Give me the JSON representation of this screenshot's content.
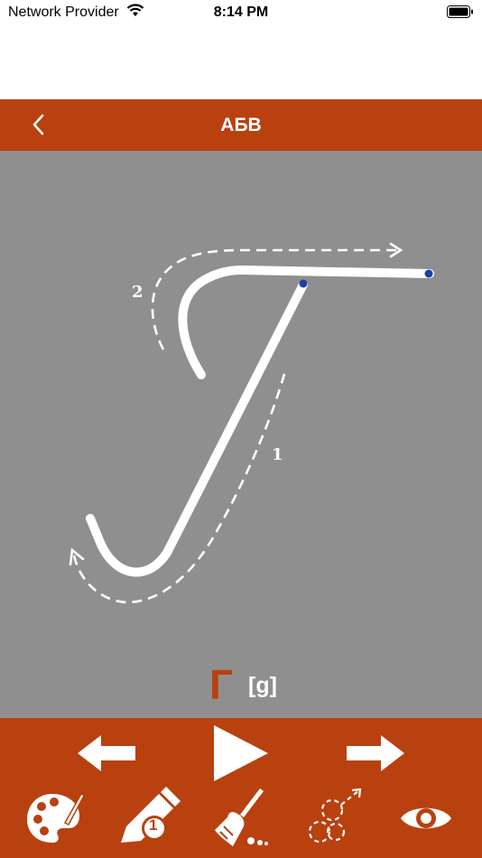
{
  "status_bar": {
    "carrier": "Network Provider",
    "time": "8:14 PM"
  },
  "nav": {
    "title": "АБВ",
    "back_icon": "chevron-left-icon"
  },
  "lesson": {
    "letter": "Г",
    "sound": "[g]",
    "stroke_labels": [
      "1",
      "2"
    ]
  },
  "toolbar": {
    "previous_icon": "arrow-left-icon",
    "play_icon": "play-icon",
    "next_icon": "arrow-right-icon",
    "palette_icon": "palette-icon",
    "pencil_icon": "pencil-icon",
    "pencil_badge": "1",
    "brush_icon": "broom-icon",
    "trace_icon": "trace-path-icon",
    "eye_icon": "eye-icon"
  },
  "colors": {
    "accent": "#b8410f",
    "canvas": "#8f8f8f",
    "stroke": "#ffffff",
    "marker": "#1a3fa6"
  }
}
